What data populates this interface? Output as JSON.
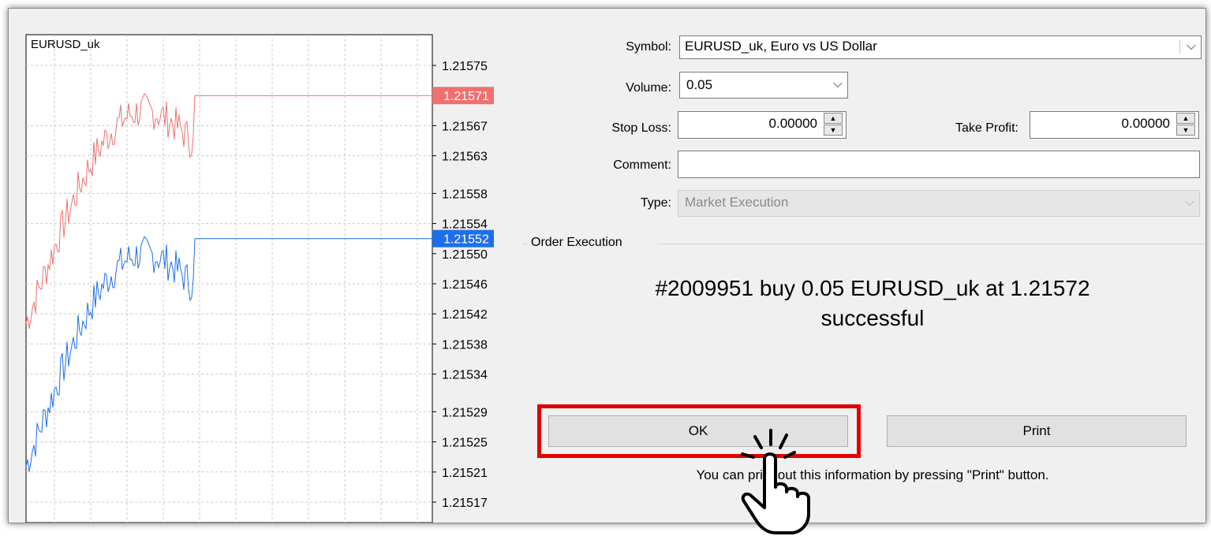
{
  "chart": {
    "symbol_label": "EURUSD_uk",
    "price_ticks": [
      "1.21575",
      "1.21567",
      "1.21563",
      "1.21558",
      "1.21554",
      "1.21550",
      "1.21546",
      "1.21542",
      "1.21538",
      "1.21534",
      "1.21529",
      "1.21525",
      "1.21521",
      "1.21517"
    ],
    "ask_price": "1.21571",
    "bid_price": "1.21552",
    "ask_color": "#f07070",
    "bid_color": "#1e6fe8"
  },
  "form": {
    "symbol_label": "Symbol:",
    "symbol_value": "EURUSD_uk, Euro vs US Dollar",
    "volume_label": "Volume:",
    "volume_value": "0.05",
    "stop_loss_label": "Stop Loss:",
    "stop_loss_value": "0.00000",
    "take_profit_label": "Take Profit:",
    "take_profit_value": "0.00000",
    "comment_label": "Comment:",
    "comment_value": "",
    "type_label": "Type:",
    "type_value": "Market Execution"
  },
  "execution": {
    "group_title": "Order Execution",
    "message_line1": "#2009951 buy 0.05 EURUSD_uk at 1.21572",
    "message_line2": "successful",
    "ok_label": "OK",
    "print_label": "Print",
    "hint_text": "You can print out this information by pressing \"Print\" button."
  },
  "icons": {
    "dropdown": "chevron-down-icon",
    "spinner": "spinner-icon",
    "cursor": "hand-pointer-icon"
  },
  "highlight_color": "#e00000"
}
